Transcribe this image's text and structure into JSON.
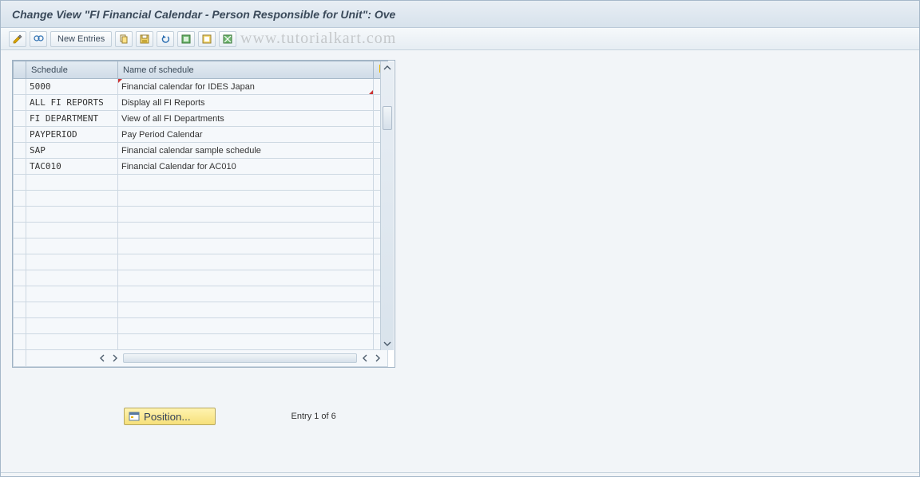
{
  "title": "Change View \"FI Financial Calendar - Person Responsible for Unit\": Ove",
  "watermark": "www.tutorialkart.com",
  "toolbar": {
    "new_entries_label": "New Entries",
    "icons": {
      "toggle": "toggle-edit-icon",
      "glasses": "detail-icon",
      "copy": "copy-icon",
      "save": "save-icon",
      "undo": "undo-icon",
      "select_all": "select-all-icon",
      "select_block": "select-block-icon",
      "deselect": "deselect-icon"
    }
  },
  "table": {
    "headers": {
      "col1": "Schedule",
      "col2": "Name of schedule"
    },
    "rows": [
      {
        "schedule": "5000",
        "name": "Financial calendar for IDES Japan"
      },
      {
        "schedule": "ALL FI REPORTS",
        "name": "Display all FI Reports"
      },
      {
        "schedule": "FI DEPARTMENT",
        "name": "View of all FI Departments"
      },
      {
        "schedule": "PAYPERIOD",
        "name": "Pay Period Calendar"
      },
      {
        "schedule": "SAP",
        "name": "Financial calendar sample schedule"
      },
      {
        "schedule": "TAC010",
        "name": "Financial Calendar for AC010"
      }
    ],
    "empty_rows": 11
  },
  "footer": {
    "position_label": "Position...",
    "entry_text": "Entry 1 of 6"
  }
}
